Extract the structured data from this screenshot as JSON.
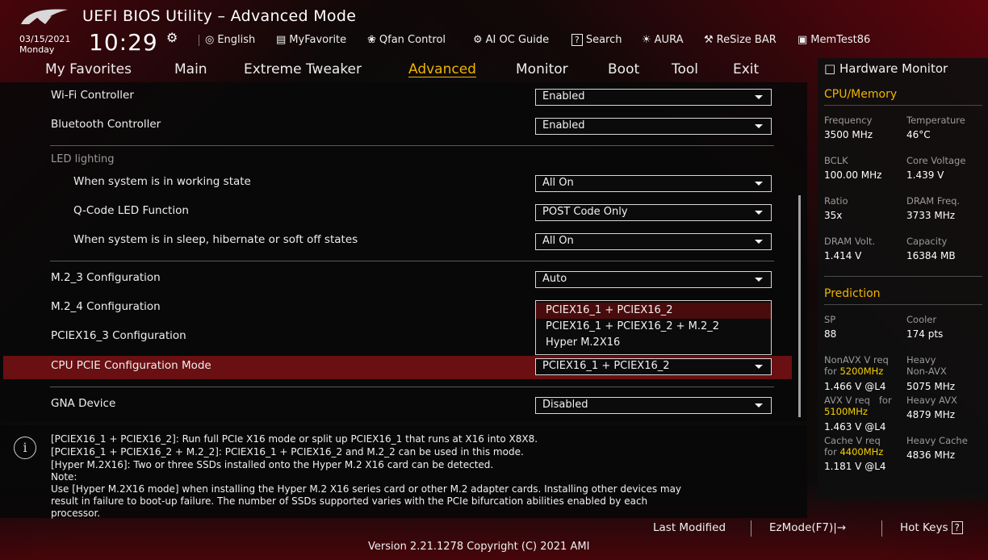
{
  "app": {
    "title": "UEFI BIOS Utility – Advanced Mode",
    "date": "03/15/2021",
    "day": "Monday",
    "time": "10:29"
  },
  "toolbar": [
    {
      "icon": "globe-icon",
      "glyph": "◎",
      "label": "English"
    },
    {
      "icon": "favorite-icon",
      "glyph": "▤",
      "label": "MyFavorite"
    },
    {
      "icon": "fan-icon",
      "glyph": "❀",
      "label": "Qfan Control"
    },
    {
      "icon": "ai-oc-icon",
      "glyph": "⚙",
      "label": "AI OC Guide"
    },
    {
      "icon": "search-icon",
      "glyph": "?",
      "label": "Search"
    },
    {
      "icon": "aura-icon",
      "glyph": "☀",
      "label": "AURA"
    },
    {
      "icon": "resize-bar-icon",
      "glyph": "⚒",
      "label": "ReSize BAR"
    },
    {
      "icon": "memtest-icon",
      "glyph": "▣",
      "label": "MemTest86"
    }
  ],
  "tabs": [
    "My Favorites",
    "Main",
    "Extreme Tweaker",
    "Advanced",
    "Monitor",
    "Boot",
    "Tool",
    "Exit"
  ],
  "active_tab": "Advanced",
  "settings": {
    "wifi": {
      "label": "Wi-Fi Controller",
      "value": "Enabled"
    },
    "bluetooth": {
      "label": "Bluetooth Controller",
      "value": "Enabled"
    },
    "led_section": "LED lighting",
    "working_state": {
      "label": "When system is in working state",
      "value": "All On"
    },
    "qcode": {
      "label": "Q-Code LED Function",
      "value": "POST Code Only"
    },
    "sleep_state": {
      "label": "When system is in sleep, hibernate or soft off states",
      "value": "All On"
    },
    "m2_3": {
      "label": "M.2_3 Configuration",
      "value": "Auto"
    },
    "m2_4": {
      "label": "M.2_4 Configuration"
    },
    "pciex16_3": {
      "label": "PCIEX16_3 Configuration"
    },
    "cpu_pcie": {
      "label": "CPU PCIE Configuration Mode",
      "value": "PCIEX16_1 + PCIEX16_2"
    },
    "gna": {
      "label": "GNA Device",
      "value": "Disabled"
    }
  },
  "dropdown_options": [
    "PCIEX16_1 + PCIEX16_2",
    "PCIEX16_1 + PCIEX16_2 + M.2_2",
    "Hyper M.2X16"
  ],
  "help_lines": [
    "[PCIEX16_1 + PCIEX16_2]: Run full PCIe X16 mode or split up PCIEX16_1 that runs at X16 into X8X8.",
    "[PCIEX16_1 + PCIEX16_2 + M.2_2]: PCIEX16_1 + PCIEX16_2 and M.2_2 can be used in this mode.",
    "[Hyper M.2X16]: Two or three SSDs installed onto the Hyper M.2 X16 card can be detected.",
    "Note:",
    "Use [Hyper M.2X16 mode] when installing the Hyper M.2 X16 series card or other M.2 adapter cards. Installing other devices may",
    "result in failure to boot-up failure. The number of SSDs supported varies with the PCIe bifurcation abilities enabled by each",
    "processor."
  ],
  "hardware_monitor": {
    "title": "Hardware Monitor",
    "cpu_memory_title": "CPU/Memory",
    "frequency_label": "Frequency",
    "frequency": "3500 MHz",
    "temperature_label": "Temperature",
    "temperature": "46°C",
    "bclk_label": "BCLK",
    "bclk": "100.00 MHz",
    "core_voltage_label": "Core Voltage",
    "core_voltage": "1.439 V",
    "ratio_label": "Ratio",
    "ratio": "35x",
    "dram_freq_label": "DRAM Freq.",
    "dram_freq": "3733 MHz",
    "dram_volt_label": "DRAM Volt.",
    "dram_volt": "1.414 V",
    "capacity_label": "Capacity",
    "capacity": "16384 MB",
    "prediction_title": "Prediction",
    "sp_label": "SP",
    "sp": "88",
    "cooler_label": "Cooler",
    "cooler": "174 pts",
    "nonavx_label": "NonAVX V req",
    "nonavx_for": "for",
    "nonavx_freq": "5200MHz",
    "nonavx_val": "1.466 V @L4",
    "heavy_nonavx_label1": "Heavy",
    "heavy_nonavx_label2": "Non-AVX",
    "heavy_nonavx": "5075 MHz",
    "avx_label": "AVX V req",
    "avx_for": "for",
    "avx_freq": "5100MHz",
    "avx_val": "1.463 V @L4",
    "heavy_avx_label": "Heavy AVX",
    "heavy_avx": "4879 MHz",
    "cache_label": "Cache V req",
    "cache_for": "for",
    "cache_freq": "4400MHz",
    "cache_val": "1.181 V @L4",
    "heavy_cache_label": "Heavy Cache",
    "heavy_cache": "4836 MHz"
  },
  "footer": {
    "last_modified": "Last Modified",
    "ezmode": "EzMode(F7)|",
    "ezmode_icon": "→",
    "hotkeys": "Hot Keys",
    "hotkeys_icon": "?",
    "version": "Version 2.21.1278 Copyright (C) 2021 AMI"
  }
}
